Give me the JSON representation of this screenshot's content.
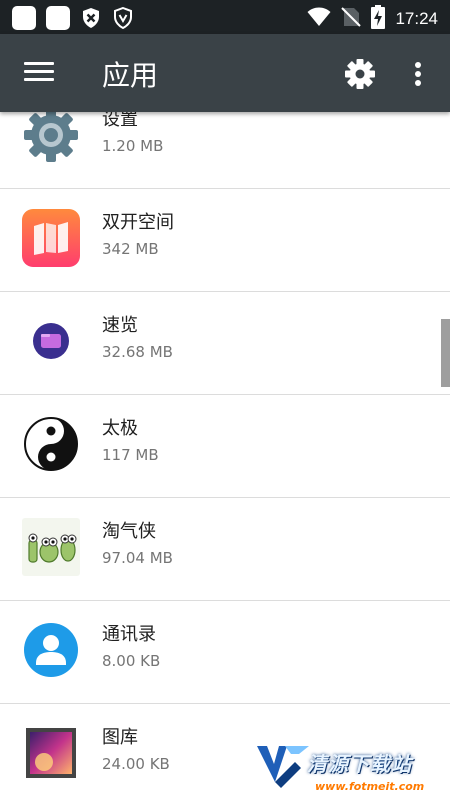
{
  "status_bar": {
    "time": "17:24",
    "icons": [
      "notification-square-icon",
      "notification-square-icon",
      "shield-x-icon",
      "shield-v-icon",
      "wifi-icon",
      "no-sim-icon",
      "battery-charging-icon"
    ]
  },
  "app_bar": {
    "title": "应用",
    "icons": [
      "menu-icon",
      "gear-icon",
      "more-vert-icon"
    ]
  },
  "apps": [
    {
      "name": "设置",
      "size": "1.20 MB",
      "icon": "settings-gear-icon"
    },
    {
      "name": "双开空间",
      "size": "342 MB",
      "icon": "dual-space-icon"
    },
    {
      "name": "速览",
      "size": "32.68 MB",
      "icon": "quick-view-icon"
    },
    {
      "name": "太极",
      "size": "117 MB",
      "icon": "yin-yang-icon"
    },
    {
      "name": "淘气侠",
      "size": "97.04 MB",
      "icon": "frog-icon"
    },
    {
      "name": "通讯录",
      "size": "8.00 KB",
      "icon": "contact-person-icon"
    },
    {
      "name": "图库",
      "size": "24.00 KB",
      "icon": "gallery-icon"
    }
  ],
  "watermark": {
    "title": "清源下载站",
    "subtitle": "www.fotmeit.com"
  },
  "colors": {
    "status_bar_bg": "#1d2225",
    "app_bar_bg": "#3a4247",
    "divider": "#dcdcdc",
    "secondary_text": "#757575"
  }
}
